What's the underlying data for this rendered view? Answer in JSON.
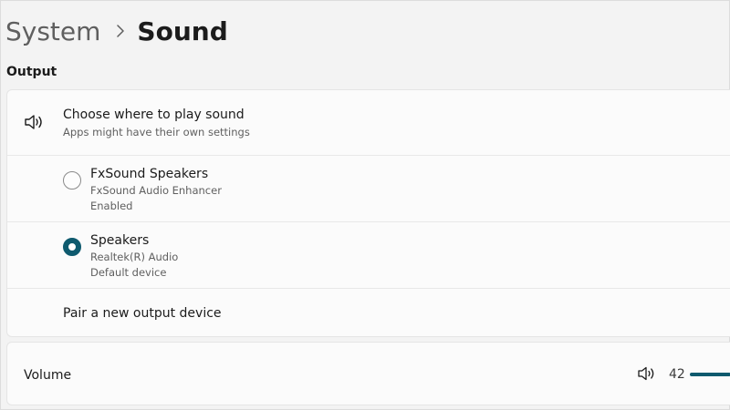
{
  "breadcrumb": {
    "parent": "System",
    "current": "Sound"
  },
  "output": {
    "section_title": "Output",
    "choose": {
      "title": "Choose where to play sound",
      "subtitle": "Apps might have their own settings"
    },
    "devices": [
      {
        "name": "FxSound Speakers",
        "line1": "FxSound Audio Enhancer",
        "line2": "Enabled",
        "selected": false
      },
      {
        "name": "Speakers",
        "line1": "Realtek(R) Audio",
        "line2": "Default device",
        "selected": true
      }
    ],
    "pair_label": "Pair a new output device"
  },
  "volume": {
    "label": "Volume",
    "value": "42",
    "level": 42
  },
  "colors": {
    "accent": "#0e5a6e",
    "background": "#f3f3f3",
    "card": "#fbfbfb"
  }
}
